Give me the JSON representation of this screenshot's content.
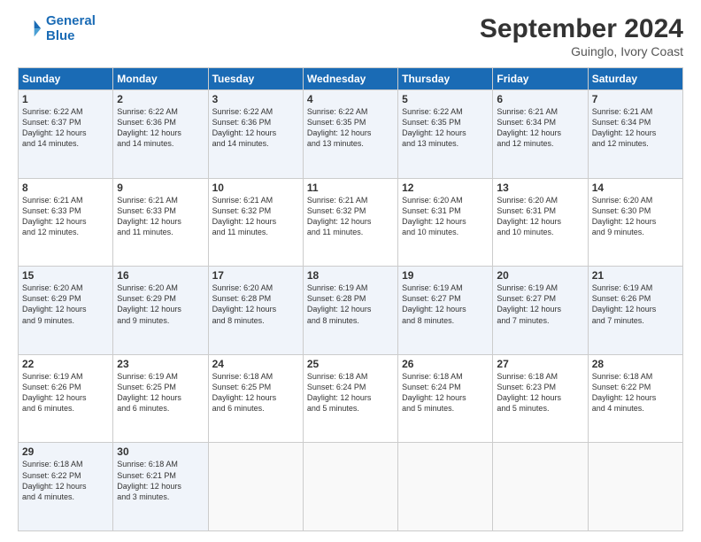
{
  "logo": {
    "line1": "General",
    "line2": "Blue"
  },
  "header": {
    "month": "September 2024",
    "location": "Guinglo, Ivory Coast"
  },
  "weekdays": [
    "Sunday",
    "Monday",
    "Tuesday",
    "Wednesday",
    "Thursday",
    "Friday",
    "Saturday"
  ],
  "weeks": [
    [
      {
        "day": "1",
        "sunrise": "6:22 AM",
        "sunset": "6:37 PM",
        "daylight": "12 hours and 14 minutes."
      },
      {
        "day": "2",
        "sunrise": "6:22 AM",
        "sunset": "6:36 PM",
        "daylight": "12 hours and 14 minutes."
      },
      {
        "day": "3",
        "sunrise": "6:22 AM",
        "sunset": "6:36 PM",
        "daylight": "12 hours and 14 minutes."
      },
      {
        "day": "4",
        "sunrise": "6:22 AM",
        "sunset": "6:35 PM",
        "daylight": "12 hours and 13 minutes."
      },
      {
        "day": "5",
        "sunrise": "6:22 AM",
        "sunset": "6:35 PM",
        "daylight": "12 hours and 13 minutes."
      },
      {
        "day": "6",
        "sunrise": "6:21 AM",
        "sunset": "6:34 PM",
        "daylight": "12 hours and 12 minutes."
      },
      {
        "day": "7",
        "sunrise": "6:21 AM",
        "sunset": "6:34 PM",
        "daylight": "12 hours and 12 minutes."
      }
    ],
    [
      {
        "day": "8",
        "sunrise": "6:21 AM",
        "sunset": "6:33 PM",
        "daylight": "12 hours and 12 minutes."
      },
      {
        "day": "9",
        "sunrise": "6:21 AM",
        "sunset": "6:33 PM",
        "daylight": "12 hours and 11 minutes."
      },
      {
        "day": "10",
        "sunrise": "6:21 AM",
        "sunset": "6:32 PM",
        "daylight": "12 hours and 11 minutes."
      },
      {
        "day": "11",
        "sunrise": "6:21 AM",
        "sunset": "6:32 PM",
        "daylight": "12 hours and 11 minutes."
      },
      {
        "day": "12",
        "sunrise": "6:20 AM",
        "sunset": "6:31 PM",
        "daylight": "12 hours and 10 minutes."
      },
      {
        "day": "13",
        "sunrise": "6:20 AM",
        "sunset": "6:31 PM",
        "daylight": "12 hours and 10 minutes."
      },
      {
        "day": "14",
        "sunrise": "6:20 AM",
        "sunset": "6:30 PM",
        "daylight": "12 hours and 9 minutes."
      }
    ],
    [
      {
        "day": "15",
        "sunrise": "6:20 AM",
        "sunset": "6:29 PM",
        "daylight": "12 hours and 9 minutes."
      },
      {
        "day": "16",
        "sunrise": "6:20 AM",
        "sunset": "6:29 PM",
        "daylight": "12 hours and 9 minutes."
      },
      {
        "day": "17",
        "sunrise": "6:20 AM",
        "sunset": "6:28 PM",
        "daylight": "12 hours and 8 minutes."
      },
      {
        "day": "18",
        "sunrise": "6:19 AM",
        "sunset": "6:28 PM",
        "daylight": "12 hours and 8 minutes."
      },
      {
        "day": "19",
        "sunrise": "6:19 AM",
        "sunset": "6:27 PM",
        "daylight": "12 hours and 8 minutes."
      },
      {
        "day": "20",
        "sunrise": "6:19 AM",
        "sunset": "6:27 PM",
        "daylight": "12 hours and 7 minutes."
      },
      {
        "day": "21",
        "sunrise": "6:19 AM",
        "sunset": "6:26 PM",
        "daylight": "12 hours and 7 minutes."
      }
    ],
    [
      {
        "day": "22",
        "sunrise": "6:19 AM",
        "sunset": "6:26 PM",
        "daylight": "12 hours and 6 minutes."
      },
      {
        "day": "23",
        "sunrise": "6:19 AM",
        "sunset": "6:25 PM",
        "daylight": "12 hours and 6 minutes."
      },
      {
        "day": "24",
        "sunrise": "6:18 AM",
        "sunset": "6:25 PM",
        "daylight": "12 hours and 6 minutes."
      },
      {
        "day": "25",
        "sunrise": "6:18 AM",
        "sunset": "6:24 PM",
        "daylight": "12 hours and 5 minutes."
      },
      {
        "day": "26",
        "sunrise": "6:18 AM",
        "sunset": "6:24 PM",
        "daylight": "12 hours and 5 minutes."
      },
      {
        "day": "27",
        "sunrise": "6:18 AM",
        "sunset": "6:23 PM",
        "daylight": "12 hours and 5 minutes."
      },
      {
        "day": "28",
        "sunrise": "6:18 AM",
        "sunset": "6:22 PM",
        "daylight": "12 hours and 4 minutes."
      }
    ],
    [
      {
        "day": "29",
        "sunrise": "6:18 AM",
        "sunset": "6:22 PM",
        "daylight": "12 hours and 4 minutes."
      },
      {
        "day": "30",
        "sunrise": "6:18 AM",
        "sunset": "6:21 PM",
        "daylight": "12 hours and 3 minutes."
      },
      null,
      null,
      null,
      null,
      null
    ]
  ],
  "labels": {
    "sunrise": "Sunrise:",
    "sunset": "Sunset:",
    "daylight": "Daylight:"
  }
}
